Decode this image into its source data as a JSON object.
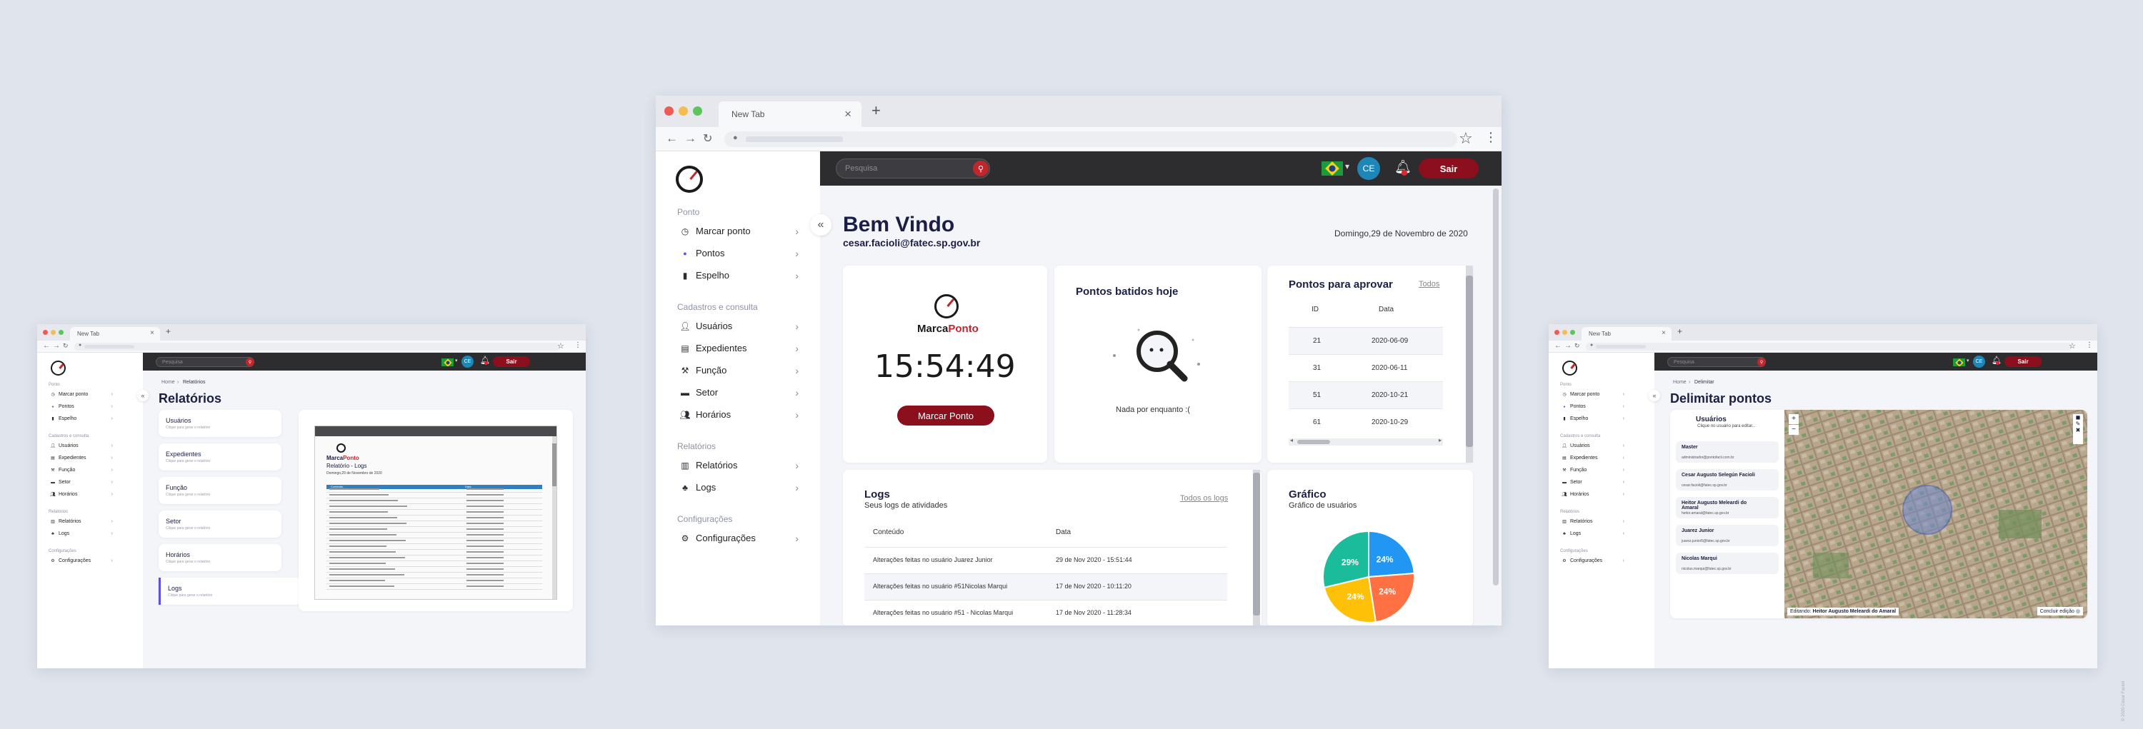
{
  "browser": {
    "tab_title": "New Tab",
    "tab_close": "×",
    "new_tab": "+"
  },
  "topbar": {
    "search_placeholder": "Pesquisa",
    "avatar_initials": "CE",
    "logout_label": "Sair"
  },
  "sidebar": {
    "sections": [
      {
        "label": "Ponto",
        "items": [
          {
            "label": "Marcar ponto",
            "icon": "clock-icon"
          },
          {
            "label": "Pontos",
            "icon": "dot-icon"
          },
          {
            "label": "Espelho",
            "icon": "book-icon"
          }
        ]
      },
      {
        "label": "Cadastros e consulta",
        "items": [
          {
            "label": "Usuários",
            "icon": "user-icon"
          },
          {
            "label": "Expedientes",
            "icon": "clipboard-icon"
          },
          {
            "label": "Função",
            "icon": "hammer-icon"
          },
          {
            "label": "Setor",
            "icon": "briefcase-icon"
          },
          {
            "label": "Horários",
            "icon": "users-icon"
          }
        ]
      },
      {
        "label": "Relatórios",
        "items": [
          {
            "label": "Relatórios",
            "icon": "chart-icon"
          },
          {
            "label": "Logs",
            "icon": "shapes-icon"
          }
        ]
      },
      {
        "label": "Configurações",
        "items": [
          {
            "label": "Configurações",
            "icon": "gear-icon"
          }
        ]
      }
    ]
  },
  "dashboard": {
    "welcome": "Bem Vindo",
    "email": "cesar.facioli@fatec.sp.gov.br",
    "date": "Domingo,29 de Novembro de 2020",
    "clock_card": {
      "brand_a": "Marca",
      "brand_b": "Ponto",
      "time": "15:54:49",
      "button": "Marcar Ponto"
    },
    "today_card": {
      "title": "Pontos batidos hoje",
      "empty": "Nada por enquanto :("
    },
    "approve_card": {
      "title": "Pontos para aprovar",
      "link": "Todos",
      "columns": [
        "ID",
        "Data"
      ],
      "rows": [
        {
          "id": "21",
          "date": "2020-06-09"
        },
        {
          "id": "31",
          "date": "2020-06-11"
        },
        {
          "id": "51",
          "date": "2020-10-21"
        },
        {
          "id": "61",
          "date": "2020-10-29"
        }
      ]
    },
    "logs_card": {
      "title": "Logs",
      "subtitle": "Seus logs de atividades",
      "link": "Todos os logs",
      "columns": [
        "Conteúdo",
        "Data"
      ],
      "rows": [
        {
          "content": "Alterações feitas no usuário Juarez Junior",
          "date": "29 de Nov 2020 - 15:51:44"
        },
        {
          "content": "Alterações feitas no usuário #51Nicolas Marqui",
          "date": "17 de Nov 2020 - 10:11:20"
        },
        {
          "content": "Alterações feitas no usuário #51 - Nicolas Marqui",
          "date": "17 de Nov 2020 - 11:28:34"
        }
      ]
    },
    "chart_card": {
      "title": "Gráfico",
      "subtitle": "Gráfico de usuários"
    }
  },
  "chart_data": {
    "type": "pie",
    "categories": [
      "",
      "",
      "",
      ""
    ],
    "values": [
      24,
      24,
      24,
      29
    ],
    "labels": [
      "24%",
      "24%",
      "24%",
      "29%"
    ],
    "colors": [
      "#2196f3",
      "#ff7043",
      "#ffc107",
      "#1bbc9b"
    ]
  },
  "reports_page": {
    "breadcrumb_home": "Home",
    "breadcrumb_current": "Relatórios",
    "title": "Relatórios",
    "items": [
      {
        "label": "Usuários",
        "hint": "Clique para gerar o relatório"
      },
      {
        "label": "Expedientes",
        "hint": "Clique para gerar o relatório"
      },
      {
        "label": "Função",
        "hint": "Clique para gerar o relatório"
      },
      {
        "label": "Setor",
        "hint": "Clique para gerar o relatório"
      },
      {
        "label": "Horários",
        "hint": "Clique para gerar o relatório"
      },
      {
        "label": "Logs",
        "hint": "Clique para gerar o relatório"
      }
    ],
    "preview": {
      "brand_a": "Marca",
      "brand_b": "Ponto",
      "title": "Relatório - Logs",
      "date": "Domingo,29 de Novembro de 2020",
      "columns": [
        "Conteúdo",
        "Data"
      ]
    }
  },
  "map_page": {
    "breadcrumb_home": "Home",
    "breadcrumb_current": "Delimitar",
    "title": "Delimitar pontos",
    "users_title": "Usuários",
    "users_hint": "Clique no usuário para editar...",
    "users": [
      {
        "name": "Master",
        "email": "administrador@pontofacil.com.br"
      },
      {
        "name": "Cesar Augusto Selegún Facioli",
        "email": "cesar.facioli@fatec.sp.gov.br"
      },
      {
        "name": "Heitor Augusto Meleardi do Amaral",
        "email": "heitor.amaral@fatec.sp.gov.br"
      },
      {
        "name": "Juarez Junior",
        "email": "juarez.junior5@fatec.sp.gov.br"
      },
      {
        "name": "Nicolas Marqui",
        "email": "nicolas.marqui@fatec.sp.gov.br"
      }
    ],
    "editing_label": "Editando:",
    "editing_name": "Heitor Augusto Meleardi do Amaral",
    "finish_edit": "Concluir edição",
    "zoom_in": "+",
    "zoom_out": "−"
  },
  "watermark": "© 2020 Cesar Facioli"
}
